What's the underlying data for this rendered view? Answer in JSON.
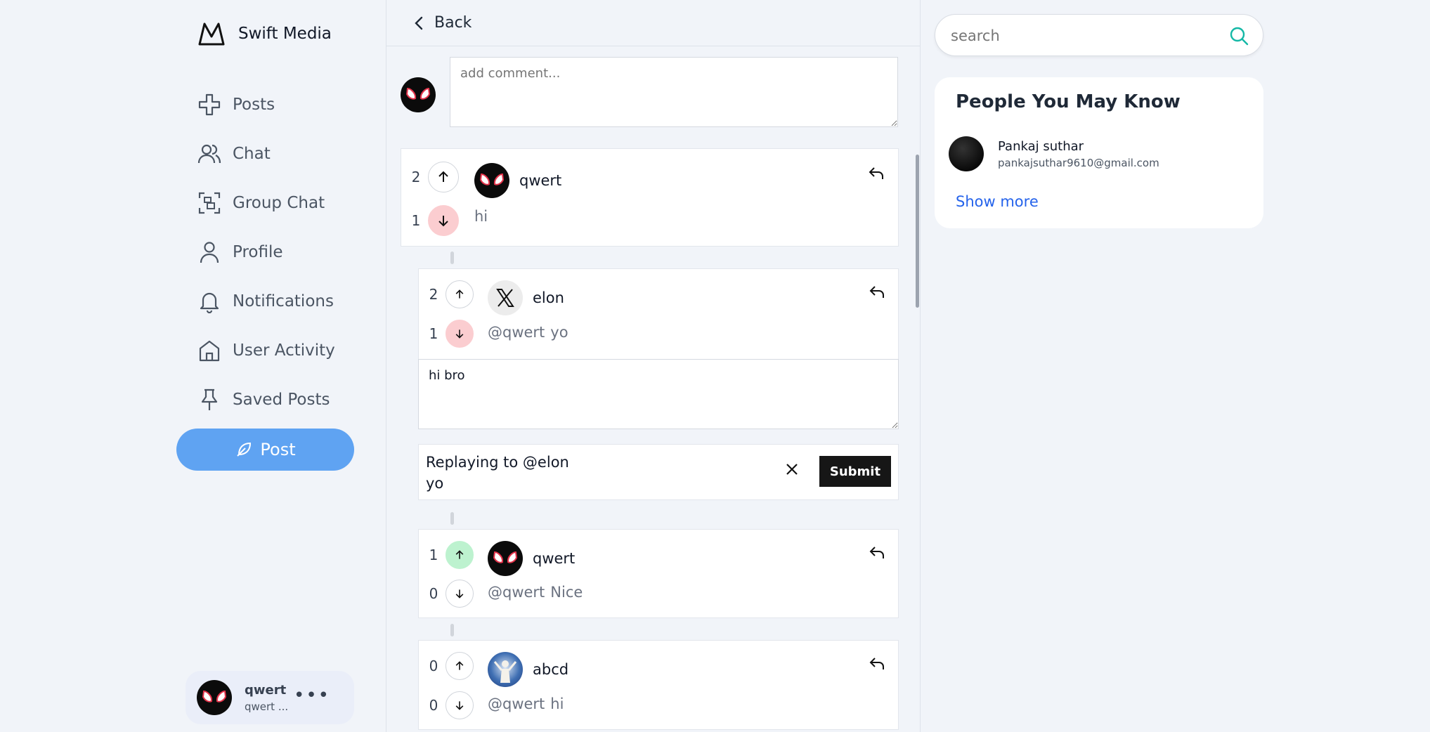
{
  "brand": {
    "name": "Swift Media",
    "icon": "mountain-logo-icon"
  },
  "nav": [
    {
      "label": "Posts",
      "icon": "plus-cross-icon"
    },
    {
      "label": "Chat",
      "icon": "users-icon"
    },
    {
      "label": "Group Chat",
      "icon": "scan-group-icon"
    },
    {
      "label": "Profile",
      "icon": "user-icon"
    },
    {
      "label": "Notifications",
      "icon": "bell-icon"
    },
    {
      "label": "User Activity",
      "icon": "home-icon"
    },
    {
      "label": "Saved Posts",
      "icon": "pin-icon"
    }
  ],
  "post_button": {
    "label": "Post",
    "icon": "feather-icon"
  },
  "current_user": {
    "name": "qwert",
    "handle": "qwert ...",
    "more": "•••"
  },
  "topbar": {
    "back_label": "Back"
  },
  "compose": {
    "placeholder": "add comment..."
  },
  "comments": [
    {
      "up": "2",
      "down": "1",
      "user": "qwert",
      "mention": "",
      "text": "hi",
      "vote_state": "down"
    },
    {
      "up": "2",
      "down": "1",
      "user": "elon",
      "mention": "@qwert",
      "text": "yo",
      "vote_state": "down"
    },
    {
      "up": "1",
      "down": "0",
      "user": "qwert",
      "mention": "@qwert",
      "text": "Nice",
      "vote_state": "up"
    },
    {
      "up": "0",
      "down": "0",
      "user": "abcd",
      "mention": "@qwert",
      "text": "hi",
      "vote_state": "none"
    }
  ],
  "reply_box": {
    "value": "hi bro"
  },
  "replying": {
    "line1": "Replaying to @elon",
    "line2": "yo",
    "submit": "Submit"
  },
  "search": {
    "placeholder": "search"
  },
  "pymk": {
    "title": "People You May Know",
    "people": [
      {
        "name": "Pankaj suthar",
        "email": "pankajsuthar9610@gmail.com"
      }
    ],
    "show_more": "Show more"
  },
  "colors": {
    "accent": "#5fa3f2",
    "downvoted": "#fbcdd0",
    "upvoted": "#bdf2cf",
    "search_icon": "#14b8a6",
    "link": "#2563eb"
  }
}
